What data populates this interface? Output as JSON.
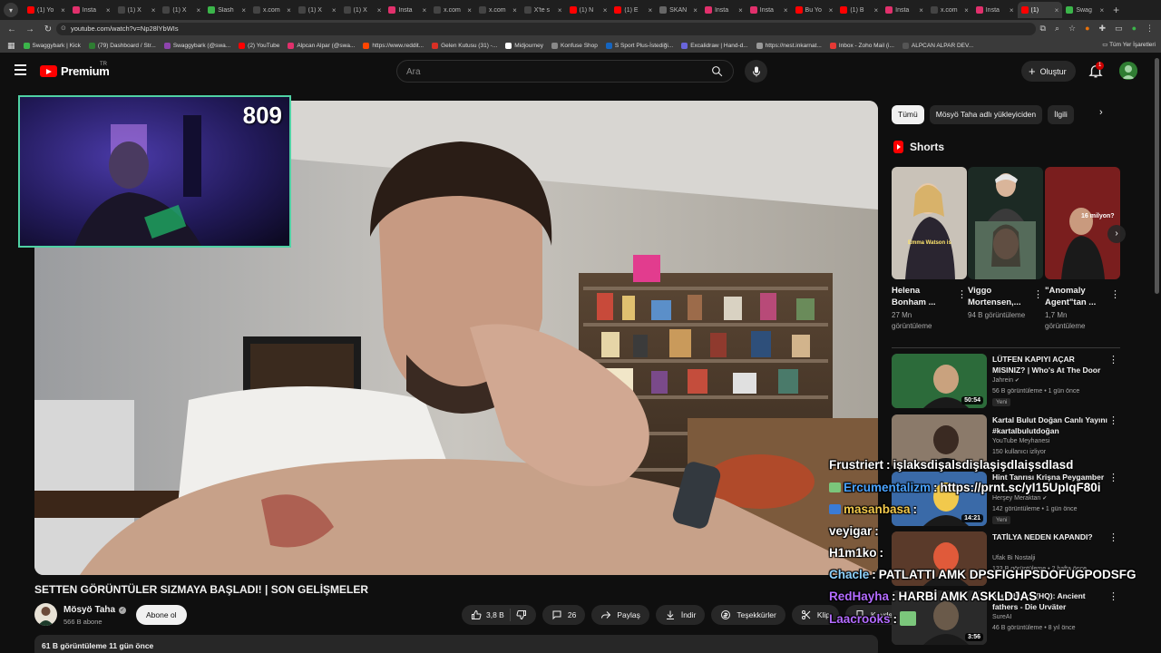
{
  "browser": {
    "tabs": [
      {
        "title": "(1) Yo",
        "color": "#ff0000"
      },
      {
        "title": "Insta",
        "color": "#e1306c"
      },
      {
        "title": "(1) X",
        "color": "#444444"
      },
      {
        "title": "(1) X",
        "color": "#444444"
      },
      {
        "title": "Slash",
        "color": "#3bb54a"
      },
      {
        "title": "x.com",
        "color": "#444444"
      },
      {
        "title": "(1) X",
        "color": "#444444"
      },
      {
        "title": "(1) X",
        "color": "#444444"
      },
      {
        "title": "Insta",
        "color": "#e1306c"
      },
      {
        "title": "x.com",
        "color": "#444444"
      },
      {
        "title": "x.com",
        "color": "#444444"
      },
      {
        "title": "X'te s",
        "color": "#444444"
      },
      {
        "title": "(1) N",
        "color": "#ff0000"
      },
      {
        "title": "(1) E",
        "color": "#ff0000"
      },
      {
        "title": "SKAN",
        "color": "#666666"
      },
      {
        "title": "Insta",
        "color": "#e1306c"
      },
      {
        "title": "Insta",
        "color": "#e1306c"
      },
      {
        "title": "Bu Yo",
        "color": "#ff0000"
      },
      {
        "title": "(1) B",
        "color": "#ff0000"
      },
      {
        "title": "Insta",
        "color": "#e1306c"
      },
      {
        "title": "x.com",
        "color": "#444444"
      },
      {
        "title": "Insta",
        "color": "#e1306c"
      },
      {
        "title": "(1)",
        "color": "#ff0000",
        "active": true
      },
      {
        "title": "Swag",
        "color": "#3bb54a"
      }
    ],
    "url": "youtube.com/watch?v=Np28lYbWIs",
    "bookmarks": [
      {
        "label": "Swaggybark | Kick",
        "color": "#3bb54a"
      },
      {
        "label": "(79) Dashboard / Str...",
        "color": "#2e7d32"
      },
      {
        "label": "Swaggybark (@swa...",
        "color": "#8e44ad"
      },
      {
        "label": "(2) YouTube",
        "color": "#ff0000"
      },
      {
        "label": "Alpcan Alpar (@swa...",
        "color": "#e1306c"
      },
      {
        "label": "https://www.reddit...",
        "color": "#ff4500"
      },
      {
        "label": "Gelen Kutusu (31) -...",
        "color": "#d93025"
      },
      {
        "label": "Midjourney",
        "color": "#ffffff"
      },
      {
        "label": "Konfuse Shop",
        "color": "#888888"
      },
      {
        "label": "S Sport Plus-İstediği...",
        "color": "#1565c0"
      },
      {
        "label": "Excalidraw | Hand-d...",
        "color": "#6965db"
      },
      {
        "label": "https://nest.inkarnat...",
        "color": "#999999"
      },
      {
        "label": "Inbox - Zoho Mail (i...",
        "color": "#e53935"
      },
      {
        "label": "ALPCAN ALPAR DEV...",
        "color": "#555555"
      }
    ],
    "all_bookmarks": "Tüm Yer İşaretleri"
  },
  "masthead": {
    "logo_text": "Premium",
    "logo_region": "TR",
    "search_placeholder": "Ara",
    "create_label": "Oluştur",
    "notification_count": "1"
  },
  "webcam": {
    "counter": "809"
  },
  "video": {
    "title": "SETTEN GÖRÜNTÜLER SIZMAYA BAŞLADI! | SON GELİŞMELER",
    "channel": "Mösyö Taha",
    "subscribers": "566 B abone",
    "subscribe_label": "Abone ol",
    "likes": "3,8 B",
    "comments": "26",
    "share_label": "Paylaş",
    "download_label": "İndir",
    "thanks_label": "Teşekkürler",
    "clip_label": "Klip",
    "save_label": "Kaydet",
    "stats": "61 B görüntüleme  11 gün önce"
  },
  "sidebar": {
    "chips": [
      {
        "label": "Tümü",
        "active": true
      },
      {
        "label": "Mösyö Taha adlı yükleyiciden",
        "active": false
      },
      {
        "label": "İlgili",
        "active": false
      }
    ],
    "shorts_heading": "Shorts",
    "shorts": [
      {
        "title": "Helena Bonham ...",
        "views": "27 Mn görüntüleme",
        "thumb_caption": "Emma Watson is"
      },
      {
        "title": "Viggo Mortensen,...",
        "views": "94 B görüntüleme",
        "thumb_caption": ""
      },
      {
        "title": "\"Anomaly Agent\"tan ...",
        "views": "1,7 Mn görüntüleme",
        "thumb_caption": "16 milyon?"
      }
    ],
    "recommendations": [
      {
        "title": "LÜTFEN KAPIYI AÇAR MISINIZ? | Who's At The Door",
        "channel": "Jahrein",
        "meta": "56 B görüntüleme • 1 gün önce",
        "badge": "Yeni",
        "duration": "50:54",
        "verified": true
      },
      {
        "title": "Kartal Bulut Doğan  Canlı Yayını #kartalbulutdoğan",
        "channel": "YouTube Meyhanesi",
        "meta": "150 kullanıcı izliyor",
        "badge": "",
        "duration": "",
        "verified": false
      },
      {
        "title": "Hint Tanrısı Krişna Peygamber",
        "channel": "Herşey Meraktan",
        "meta": "142 görüntüleme • 1 gün önce",
        "badge": "Yeni",
        "duration": "14:21",
        "verified": true
      },
      {
        "title": "TATİLYA NEDEN KAPANDI?",
        "channel": "Ufak Bi Nostalji",
        "meta": "133 B görüntüleme • 2 hafta önce",
        "badge": "",
        "duration": "",
        "verified": false
      },
      {
        "title": "soundtrack (HQ): Ancient fathers - Die Urväter",
        "channel": "SureAI",
        "meta": "46 B görüntüleme • 8 yıl önce",
        "badge": "",
        "duration": "3:56",
        "verified": false
      }
    ]
  },
  "chat": [
    {
      "user": "Frustriert",
      "user_color": "#ffffff",
      "message": "işlaksdişalsdişlaşişdlaişsdlasd",
      "emote": false
    },
    {
      "user": "Ercumentalizm",
      "user_color": "#4aa3ff",
      "message": "https://prnt.sc/yI15UpIqF80i",
      "emote": true,
      "emote_color": "#7bc67b"
    },
    {
      "user": "masanbasa",
      "user_color": "#f2c94c",
      "message": "",
      "emote": true,
      "emote_color": "#3a7bd5"
    },
    {
      "user": "veyigar",
      "user_color": "#ffffff",
      "message": "",
      "emote": false
    },
    {
      "user": "H1m1ko",
      "user_color": "#ffffff",
      "message": "",
      "emote": false
    },
    {
      "user": "Chacle",
      "user_color": "#8fd3ff",
      "message": "PATLATTI AMK DPSFIGHPSDOFUGPODSFG",
      "emote": false
    },
    {
      "user": "RedHayha",
      "user_color": "#b36bff",
      "message": "HARBİ AMK ASKLDJAS",
      "emote": false
    },
    {
      "user": "Laacrooks",
      "user_color": "#b36bff",
      "message": "",
      "emote": true,
      "emote_color": "#7bc67b"
    }
  ]
}
